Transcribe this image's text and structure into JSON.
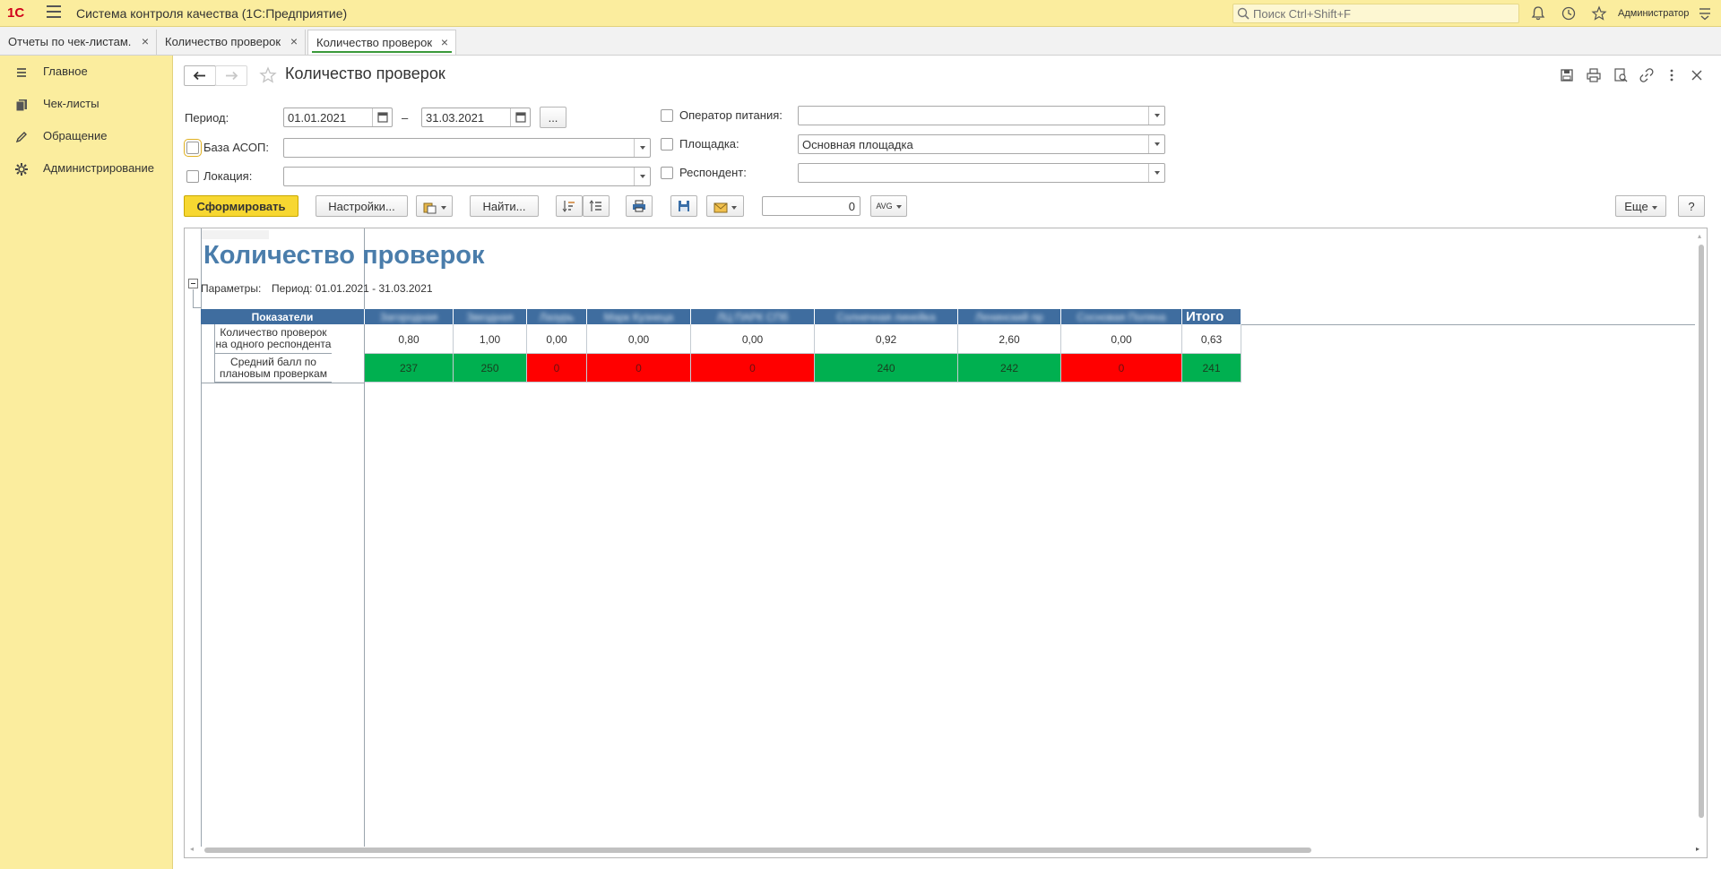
{
  "app": {
    "logo": "1С",
    "title": "Система контроля качества  (1С:Предприятие)",
    "search_placeholder": "Поиск Ctrl+Shift+F",
    "user": "Администратор"
  },
  "tabs": [
    {
      "label": "Отчеты по чек-листам.",
      "active": false
    },
    {
      "label": "Количество проверок",
      "active": false
    },
    {
      "label": "Количество проверок",
      "active": true
    }
  ],
  "sidebar": {
    "items": [
      {
        "label": "Главное",
        "icon": "list-icon"
      },
      {
        "label": "Чек-листы",
        "icon": "documents-icon"
      },
      {
        "label": "Обращение",
        "icon": "pencil-icon"
      },
      {
        "label": "Администрирование",
        "icon": "gear-icon"
      }
    ]
  },
  "form": {
    "title": "Количество проверок",
    "period_label": "Период:",
    "period_from": "01.01.2021",
    "period_dash": "–",
    "period_to": "31.03.2021",
    "period_more": "...",
    "base_label": "База АСОП:",
    "base_value": "",
    "location_label": "Локация:",
    "location_value": "",
    "operator_label": "Оператор питания:",
    "operator_value": "",
    "site_label": "Площадка:",
    "site_value": "Основная площадка",
    "respondent_label": "Респондент:",
    "respondent_value": ""
  },
  "toolbar": {
    "generate": "Сформировать",
    "settings": "Настройки...",
    "find": "Найти...",
    "sum_value": "0",
    "agg_label": "AVG",
    "more": "Еще",
    "help": "?"
  },
  "report": {
    "title": "Количество проверок",
    "params_label": "Параметры:",
    "params_value": "Период: 01.01.2021 - 31.03.2021",
    "header_indicators": "Показатели",
    "header_total": "Итого",
    "columns": [
      "Загородная",
      "Звездная",
      "Лазурь",
      "Марк Кузнеца",
      "ЛЦ ПАРК СПб",
      "Солнечная линейка",
      "Ленинский пр",
      "Сосновая Поляна"
    ],
    "rows": [
      {
        "label": "Количество проверок на одного респондента",
        "values": [
          "0,80",
          "1,00",
          "0,00",
          "0,00",
          "0,00",
          "0,92",
          "2,60",
          "0,00"
        ],
        "total": "0,63",
        "colors": [
          "",
          "",
          "",
          "",
          "",
          "",
          "",
          ""
        ],
        "total_color": ""
      },
      {
        "label": "Средний балл по плановым проверкам",
        "values": [
          "237",
          "250",
          "0",
          "0",
          "0",
          "240",
          "242",
          "0"
        ],
        "total": "241",
        "colors": [
          "green",
          "green",
          "red",
          "red",
          "red",
          "green",
          "green",
          "red"
        ],
        "total_color": "green"
      }
    ]
  },
  "colors": {
    "accent_yellow": "#fbed9e",
    "header_blue": "#3f6d9f",
    "title_blue": "#4a7dab",
    "green": "#00b050",
    "red": "#ff0000"
  }
}
